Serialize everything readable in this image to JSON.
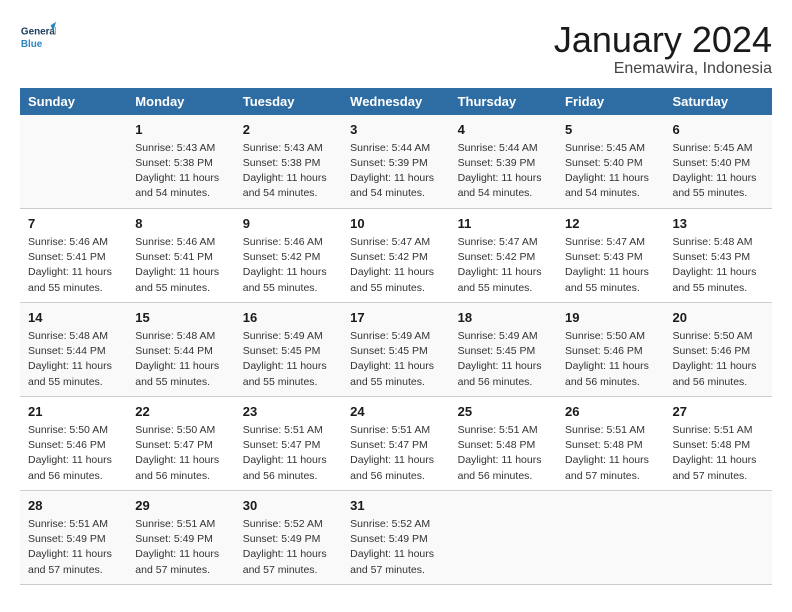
{
  "logo": {
    "line1": "General",
    "line2": "Blue"
  },
  "title": "January 2024",
  "subtitle": "Enemawira, Indonesia",
  "headers": [
    "Sunday",
    "Monday",
    "Tuesday",
    "Wednesday",
    "Thursday",
    "Friday",
    "Saturday"
  ],
  "weeks": [
    [
      {
        "day": "",
        "lines": []
      },
      {
        "day": "1",
        "lines": [
          "Sunrise: 5:43 AM",
          "Sunset: 5:38 PM",
          "Daylight: 11 hours",
          "and 54 minutes."
        ]
      },
      {
        "day": "2",
        "lines": [
          "Sunrise: 5:43 AM",
          "Sunset: 5:38 PM",
          "Daylight: 11 hours",
          "and 54 minutes."
        ]
      },
      {
        "day": "3",
        "lines": [
          "Sunrise: 5:44 AM",
          "Sunset: 5:39 PM",
          "Daylight: 11 hours",
          "and 54 minutes."
        ]
      },
      {
        "day": "4",
        "lines": [
          "Sunrise: 5:44 AM",
          "Sunset: 5:39 PM",
          "Daylight: 11 hours",
          "and 54 minutes."
        ]
      },
      {
        "day": "5",
        "lines": [
          "Sunrise: 5:45 AM",
          "Sunset: 5:40 PM",
          "Daylight: 11 hours",
          "and 54 minutes."
        ]
      },
      {
        "day": "6",
        "lines": [
          "Sunrise: 5:45 AM",
          "Sunset: 5:40 PM",
          "Daylight: 11 hours",
          "and 55 minutes."
        ]
      }
    ],
    [
      {
        "day": "7",
        "lines": [
          "Sunrise: 5:46 AM",
          "Sunset: 5:41 PM",
          "Daylight: 11 hours",
          "and 55 minutes."
        ]
      },
      {
        "day": "8",
        "lines": [
          "Sunrise: 5:46 AM",
          "Sunset: 5:41 PM",
          "Daylight: 11 hours",
          "and 55 minutes."
        ]
      },
      {
        "day": "9",
        "lines": [
          "Sunrise: 5:46 AM",
          "Sunset: 5:42 PM",
          "Daylight: 11 hours",
          "and 55 minutes."
        ]
      },
      {
        "day": "10",
        "lines": [
          "Sunrise: 5:47 AM",
          "Sunset: 5:42 PM",
          "Daylight: 11 hours",
          "and 55 minutes."
        ]
      },
      {
        "day": "11",
        "lines": [
          "Sunrise: 5:47 AM",
          "Sunset: 5:42 PM",
          "Daylight: 11 hours",
          "and 55 minutes."
        ]
      },
      {
        "day": "12",
        "lines": [
          "Sunrise: 5:47 AM",
          "Sunset: 5:43 PM",
          "Daylight: 11 hours",
          "and 55 minutes."
        ]
      },
      {
        "day": "13",
        "lines": [
          "Sunrise: 5:48 AM",
          "Sunset: 5:43 PM",
          "Daylight: 11 hours",
          "and 55 minutes."
        ]
      }
    ],
    [
      {
        "day": "14",
        "lines": [
          "Sunrise: 5:48 AM",
          "Sunset: 5:44 PM",
          "Daylight: 11 hours",
          "and 55 minutes."
        ]
      },
      {
        "day": "15",
        "lines": [
          "Sunrise: 5:48 AM",
          "Sunset: 5:44 PM",
          "Daylight: 11 hours",
          "and 55 minutes."
        ]
      },
      {
        "day": "16",
        "lines": [
          "Sunrise: 5:49 AM",
          "Sunset: 5:45 PM",
          "Daylight: 11 hours",
          "and 55 minutes."
        ]
      },
      {
        "day": "17",
        "lines": [
          "Sunrise: 5:49 AM",
          "Sunset: 5:45 PM",
          "Daylight: 11 hours",
          "and 55 minutes."
        ]
      },
      {
        "day": "18",
        "lines": [
          "Sunrise: 5:49 AM",
          "Sunset: 5:45 PM",
          "Daylight: 11 hours",
          "and 56 minutes."
        ]
      },
      {
        "day": "19",
        "lines": [
          "Sunrise: 5:50 AM",
          "Sunset: 5:46 PM",
          "Daylight: 11 hours",
          "and 56 minutes."
        ]
      },
      {
        "day": "20",
        "lines": [
          "Sunrise: 5:50 AM",
          "Sunset: 5:46 PM",
          "Daylight: 11 hours",
          "and 56 minutes."
        ]
      }
    ],
    [
      {
        "day": "21",
        "lines": [
          "Sunrise: 5:50 AM",
          "Sunset: 5:46 PM",
          "Daylight: 11 hours",
          "and 56 minutes."
        ]
      },
      {
        "day": "22",
        "lines": [
          "Sunrise: 5:50 AM",
          "Sunset: 5:47 PM",
          "Daylight: 11 hours",
          "and 56 minutes."
        ]
      },
      {
        "day": "23",
        "lines": [
          "Sunrise: 5:51 AM",
          "Sunset: 5:47 PM",
          "Daylight: 11 hours",
          "and 56 minutes."
        ]
      },
      {
        "day": "24",
        "lines": [
          "Sunrise: 5:51 AM",
          "Sunset: 5:47 PM",
          "Daylight: 11 hours",
          "and 56 minutes."
        ]
      },
      {
        "day": "25",
        "lines": [
          "Sunrise: 5:51 AM",
          "Sunset: 5:48 PM",
          "Daylight: 11 hours",
          "and 56 minutes."
        ]
      },
      {
        "day": "26",
        "lines": [
          "Sunrise: 5:51 AM",
          "Sunset: 5:48 PM",
          "Daylight: 11 hours",
          "and 57 minutes."
        ]
      },
      {
        "day": "27",
        "lines": [
          "Sunrise: 5:51 AM",
          "Sunset: 5:48 PM",
          "Daylight: 11 hours",
          "and 57 minutes."
        ]
      }
    ],
    [
      {
        "day": "28",
        "lines": [
          "Sunrise: 5:51 AM",
          "Sunset: 5:49 PM",
          "Daylight: 11 hours",
          "and 57 minutes."
        ]
      },
      {
        "day": "29",
        "lines": [
          "Sunrise: 5:51 AM",
          "Sunset: 5:49 PM",
          "Daylight: 11 hours",
          "and 57 minutes."
        ]
      },
      {
        "day": "30",
        "lines": [
          "Sunrise: 5:52 AM",
          "Sunset: 5:49 PM",
          "Daylight: 11 hours",
          "and 57 minutes."
        ]
      },
      {
        "day": "31",
        "lines": [
          "Sunrise: 5:52 AM",
          "Sunset: 5:49 PM",
          "Daylight: 11 hours",
          "and 57 minutes."
        ]
      },
      {
        "day": "",
        "lines": []
      },
      {
        "day": "",
        "lines": []
      },
      {
        "day": "",
        "lines": []
      }
    ]
  ]
}
